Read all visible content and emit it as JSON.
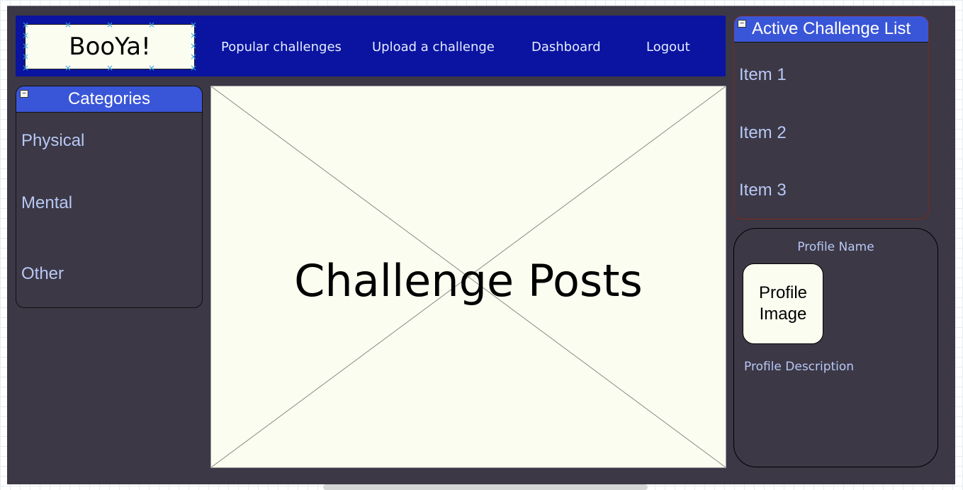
{
  "logo": {
    "text": "BooYa!"
  },
  "nav": {
    "items": [
      {
        "label": "Popular challenges"
      },
      {
        "label": "Upload a challenge"
      },
      {
        "label": "Dashboard"
      },
      {
        "label": "Logout"
      }
    ]
  },
  "categories": {
    "title": "Categories",
    "items": [
      {
        "label": "Physical"
      },
      {
        "label": "Mental"
      },
      {
        "label": "Other"
      }
    ]
  },
  "main": {
    "placeholder_label": "Challenge Posts"
  },
  "active_challenges": {
    "title": "Active Challenge List",
    "items": [
      {
        "label": "Item 1"
      },
      {
        "label": "Item 2"
      },
      {
        "label": "Item 3"
      }
    ]
  },
  "profile": {
    "name": "Profile Name",
    "image_label_line1": "Profile",
    "image_label_line2": "Image",
    "description": "Profile Description"
  },
  "colors": {
    "frame_background": "#3c3846",
    "navbar_background": "#0a14a0",
    "panel_header": "#3a56d8",
    "list_text": "#b8c8f4",
    "placeholder_fill": "#fbfdf0"
  }
}
